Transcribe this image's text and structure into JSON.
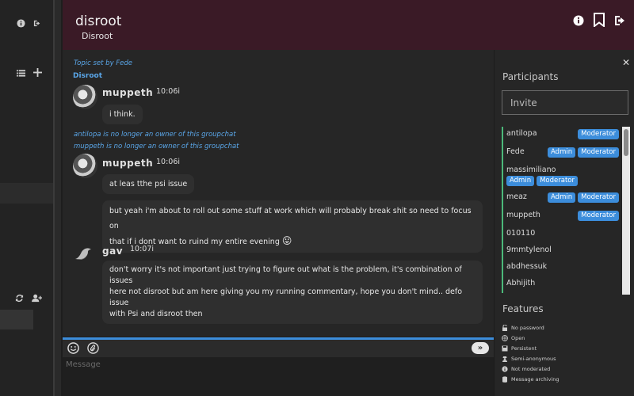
{
  "header": {
    "title": "disroot",
    "subtitle": "Disroot"
  },
  "chat": {
    "topic_set_by": "Topic set by Fede",
    "topic": "Disroot",
    "system_messages": [
      "antilopa is no longer an owner of this groupchat",
      "muppeth is no longer an owner of this groupchat"
    ],
    "messages": [
      {
        "author": "muppeth",
        "time": "10:06i",
        "texts": [
          "i think."
        ]
      },
      {
        "author": "muppeth",
        "time": "10:06i",
        "texts": [
          "at leas tthe psi issue",
          "but yeah i'm about to roll out some stuff at work which will probably break shit so need to focus on",
          "that if i dont want to ruind my entire evening"
        ],
        "emoji": "😛"
      },
      {
        "author": "gav",
        "time": "10:07i",
        "texts": [
          "don't worry it's not important just trying to figure out what is the problem, it's combination of issues",
          "here not disroot but am here giving you my running commentary, hope you don't mind.. defo issue",
          "with Psi and disroot then"
        ]
      }
    ]
  },
  "composer": {
    "placeholder": "Message",
    "send_label": "»"
  },
  "participants": {
    "title": "Participants",
    "invite_placeholder": "Invite",
    "items": [
      {
        "name": "antilopa",
        "roles": [
          "Moderator"
        ]
      },
      {
        "name": "Fede",
        "roles": [
          "Admin",
          "Moderator"
        ]
      },
      {
        "name": "massimiliano",
        "roles": [
          "Admin",
          "Moderator"
        ]
      },
      {
        "name": "meaz",
        "roles": [
          "Admin",
          "Moderator"
        ]
      },
      {
        "name": "muppeth",
        "roles": [
          "Moderator"
        ]
      },
      {
        "name": "010110",
        "roles": []
      },
      {
        "name": "9mmtylenol",
        "roles": []
      },
      {
        "name": "abdhessuk",
        "roles": []
      },
      {
        "name": "Abhijith",
        "roles": []
      }
    ]
  },
  "features": {
    "title": "Features",
    "items": [
      {
        "label": "No password",
        "icon": "unlock-icon"
      },
      {
        "label": "Open",
        "icon": "globe-icon"
      },
      {
        "label": "Persistent",
        "icon": "save-icon"
      },
      {
        "label": "Semi-anonymous",
        "icon": "user-secret-icon"
      },
      {
        "label": "Not moderated",
        "icon": "info-icon"
      },
      {
        "label": "Message archiving",
        "icon": "database-icon"
      }
    ]
  },
  "colors": {
    "header_bg": "#3a1a26",
    "accent": "#3c8ddb",
    "occupant_border": "#4bb87a",
    "info_text": "#5aa6e8"
  }
}
